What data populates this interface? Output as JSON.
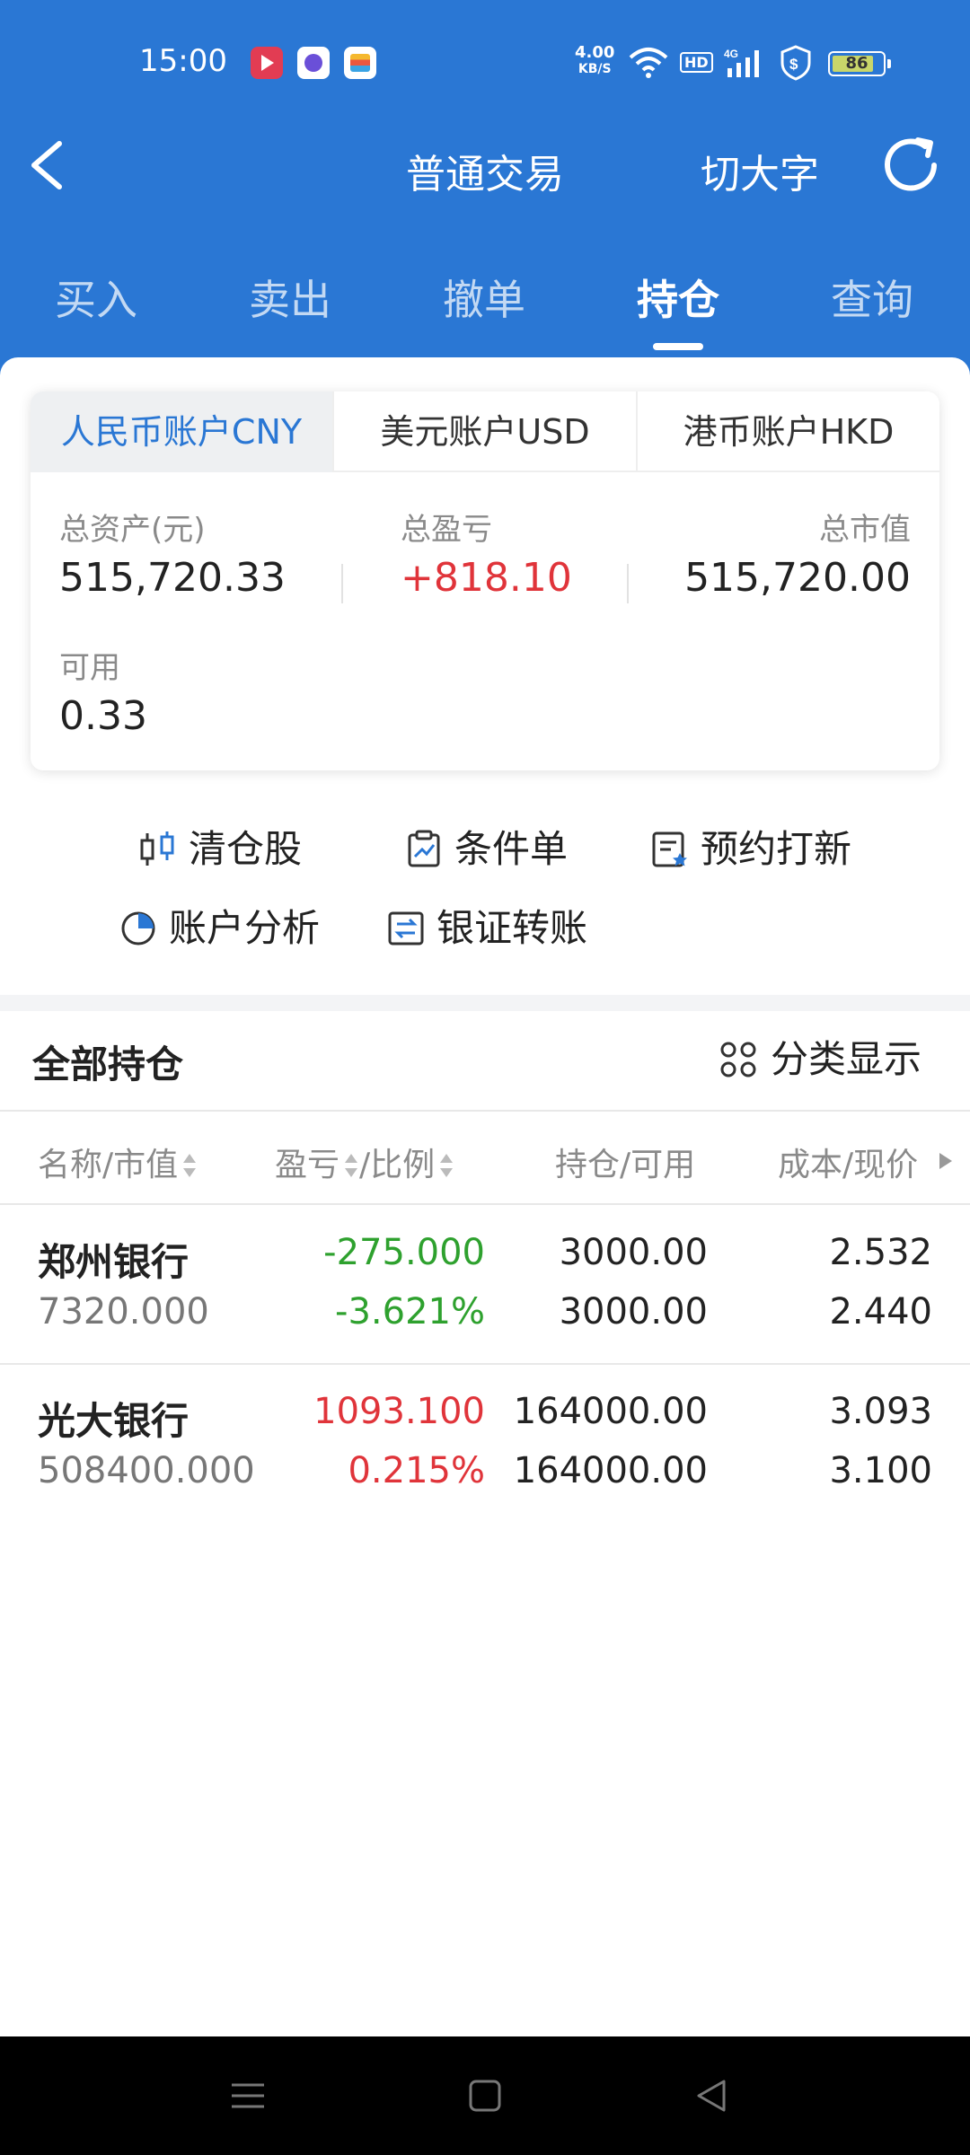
{
  "status_bar": {
    "time": "15:00",
    "net_speed_value": "4.00",
    "net_speed_unit": "KB/S",
    "hd": "HD",
    "network": "4G",
    "battery": "86",
    "icons": [
      "video-app-icon",
      "chat-app-icon",
      "wallet-app-icon",
      "wifi-icon",
      "signal-icon",
      "security-shield-icon",
      "battery-icon"
    ]
  },
  "nav": {
    "title": "普通交易",
    "big_font_label": "切大字"
  },
  "tabs": [
    {
      "label": "买入",
      "active": false
    },
    {
      "label": "卖出",
      "active": false
    },
    {
      "label": "撤单",
      "active": false
    },
    {
      "label": "持仓",
      "active": true
    },
    {
      "label": "查询",
      "active": false
    }
  ],
  "account_tabs": [
    {
      "label": "人民币账户CNY",
      "active": true
    },
    {
      "label": "美元账户USD",
      "active": false
    },
    {
      "label": "港币账户HKD",
      "active": false
    }
  ],
  "summary": {
    "total_assets_label": "总资产(元)",
    "total_assets_value": "515,720.33",
    "total_pl_label": "总盈亏",
    "total_pl_value": "+818.10",
    "market_value_label": "总市值",
    "market_value_value": "515,720.00",
    "available_label": "可用",
    "available_value": "0.33"
  },
  "functions": [
    {
      "label": "清仓股",
      "icon": "candlestick-icon"
    },
    {
      "label": "条件单",
      "icon": "clipboard-chart-icon"
    },
    {
      "label": "预约打新",
      "icon": "reserve-ipo-icon"
    },
    {
      "label": "账户分析",
      "icon": "pie-chart-icon"
    },
    {
      "label": "银证转账",
      "icon": "transfer-icon"
    }
  ],
  "holdings": {
    "title": "全部持仓",
    "classify_label": "分类显示",
    "columns": {
      "name_mv": "名称/市值",
      "pl": "盈亏",
      "ratio": "/比例",
      "position": "持仓/可用",
      "cost_price": "成本/现价"
    },
    "rows": [
      {
        "name": "郑州银行",
        "market_value": "7320.000",
        "pl": "-275.000",
        "ratio": "-3.621%",
        "position": "3000.00",
        "available": "3000.00",
        "cost": "2.532",
        "price": "2.440",
        "direction": "down"
      },
      {
        "name": "光大银行",
        "market_value": "508400.000",
        "pl": "1093.100",
        "ratio": "0.215%",
        "position": "164000.00",
        "available": "164000.00",
        "cost": "3.093",
        "price": "3.100",
        "direction": "up"
      }
    ]
  },
  "colors": {
    "brand_blue": "#2a77d4",
    "gain_red": "#e0343a",
    "loss_green": "#2ea12e"
  }
}
